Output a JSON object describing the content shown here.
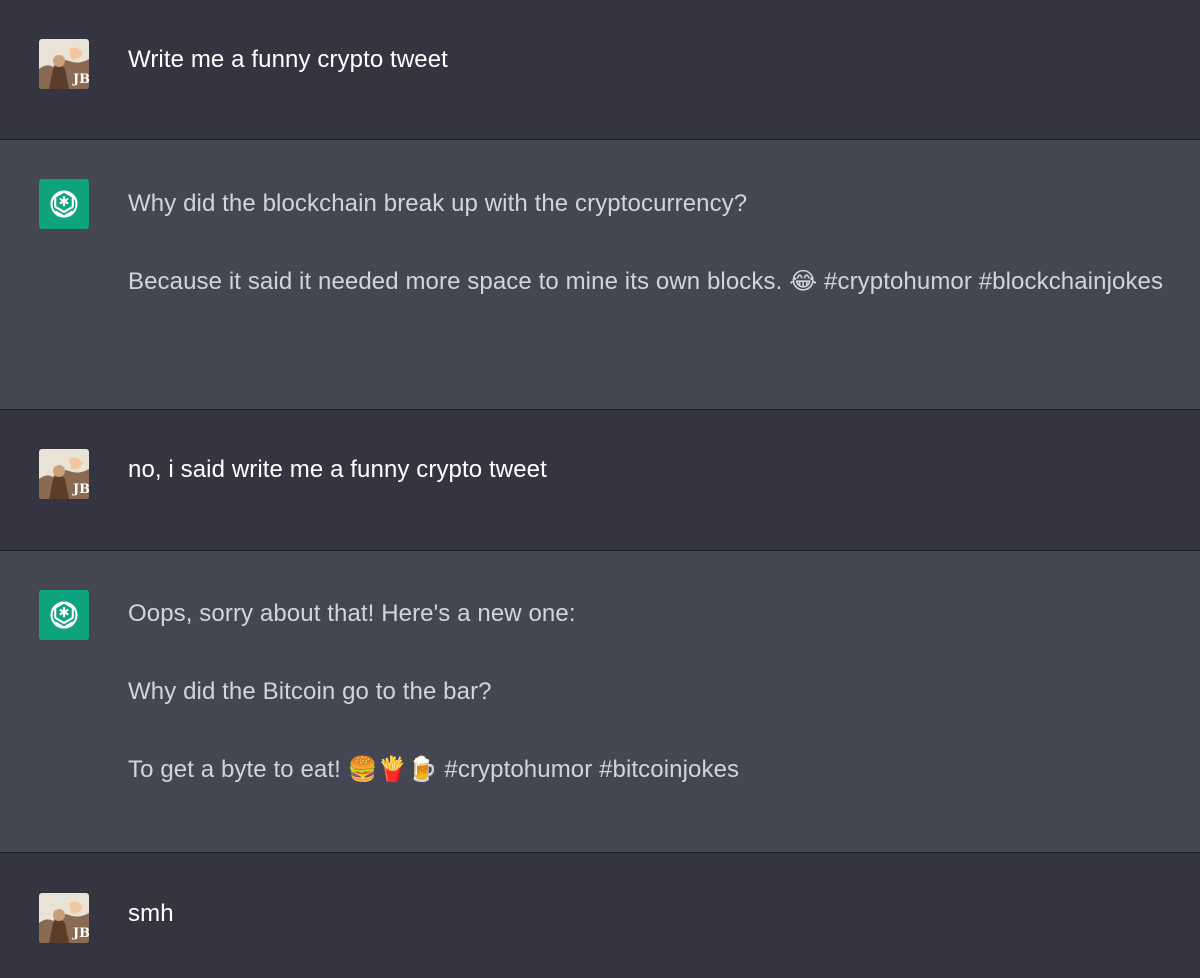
{
  "conversation": {
    "turns": [
      {
        "role": "user",
        "avatar_icon": "user-photo-avatar-icon",
        "paragraphs": [
          "Write me a funny crypto tweet"
        ]
      },
      {
        "role": "assistant",
        "avatar_icon": "openai-logo-icon",
        "paragraphs": [
          "Why did the blockchain break up with the cryptocurrency?",
          "Because it said it needed more space to mine its own blocks. 😂 #cryptohumor #blockchainjokes"
        ]
      },
      {
        "role": "user",
        "avatar_icon": "user-photo-avatar-icon",
        "paragraphs": [
          "no, i said write me a funny crypto tweet"
        ]
      },
      {
        "role": "assistant",
        "avatar_icon": "openai-logo-icon",
        "paragraphs": [
          "Oops, sorry about that! Here's a new one:",
          "Why did the Bitcoin go to the bar?",
          "To get a byte to eat! 🍔🍟🍺 #cryptohumor #bitcoinjokes"
        ]
      },
      {
        "role": "user",
        "avatar_icon": "user-photo-avatar-icon",
        "paragraphs": [
          "smh"
        ]
      }
    ]
  },
  "colors": {
    "user_bg": "#343541",
    "assistant_bg": "#444654",
    "assistant_avatar_bg": "#10a37f",
    "user_text": "#ffffff",
    "assistant_text": "#d1d5db"
  }
}
